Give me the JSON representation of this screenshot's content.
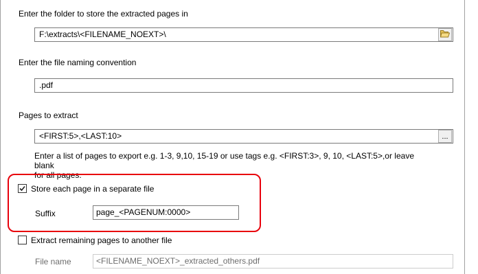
{
  "folder": {
    "label": "Enter the folder to store the extracted pages in",
    "value": "F:\\extracts\\<FILENAME_NOEXT>\\"
  },
  "naming": {
    "label": "Enter the file naming convention",
    "value": ".pdf"
  },
  "pages": {
    "label": "Pages to extract",
    "value": "<FIRST:5>,<LAST:10>",
    "picker_label": "...",
    "help_line1": "Enter a list of pages to export e.g. 1-3, 9,10, 15-19 or use tags e.g. <FIRST:3>, 9, 10, <LAST:5>,or leave blank",
    "help_line2": "for all pages."
  },
  "separate": {
    "checked": true,
    "label": "Store each page in a separate file",
    "suffix_label": "Suffix",
    "suffix_value": "page_<PAGENUM:0000>"
  },
  "remaining": {
    "checked": false,
    "label": "Extract remaining pages to another file",
    "filename_label": "File name",
    "filename_value": "<FILENAME_NOEXT>_extracted_others.pdf"
  },
  "colors": {
    "highlight": "#e8000b",
    "field_border": "#7a7a7a",
    "disabled_text": "#6d6d6d"
  },
  "icons": {
    "browse": "folder-open-icon",
    "check": "checkmark-icon"
  }
}
